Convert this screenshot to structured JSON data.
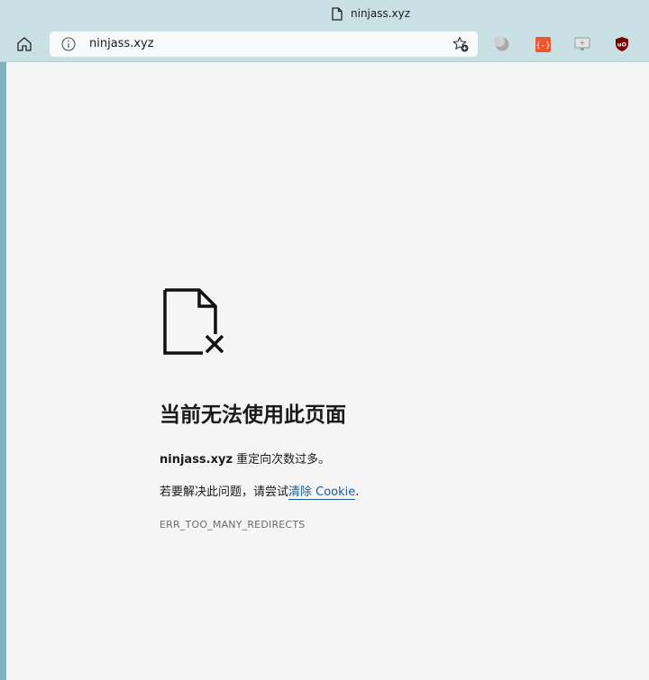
{
  "tab": {
    "title": "ninjass.xyz"
  },
  "toolbar": {
    "url": "ninjass.xyz"
  },
  "error": {
    "heading": "当前无法使用此页面",
    "host": "ninjass.xyz",
    "message": " 重定向次数过多。",
    "hint_prefix": "若要解决此问题，请尝试",
    "hint_link": "清除 Cookie",
    "hint_suffix": ".",
    "code": "ERR_TOO_MANY_REDIRECTS"
  },
  "colors": {
    "chrome": "#c9e0e4",
    "sidebar_strip": "#7fb2bd",
    "link": "#1a5f9a",
    "page_bg": "#f5f5f5"
  },
  "icons": [
    "document-icon",
    "home-icon",
    "info-icon",
    "add-favorite-icon",
    "extension-moon-icon",
    "extension-braces-icon",
    "extension-screen-icon",
    "ublock-icon",
    "broken-page-icon"
  ]
}
